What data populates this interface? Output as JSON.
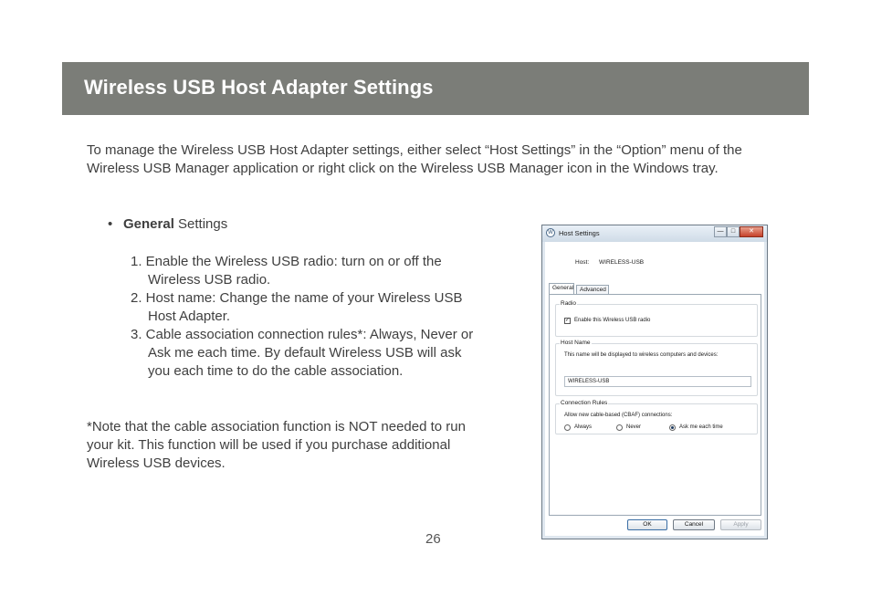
{
  "header": {
    "title": "Wireless USB Host Adapter Settings"
  },
  "intro": "To manage the Wireless USB Host Adapter settings, either select “Host Settings” in the “Option” menu of the Wireless USB Manager application or right click on the Wireless USB Manager icon in the Windows tray.",
  "bullet": {
    "marker": "•",
    "bold": "General",
    "rest": " Settings"
  },
  "steps": [
    "1. Enable the Wireless USB radio: turn on or off the Wireless USB radio.",
    "2. Host name: Change the name of your Wireless USB Host Adapter.",
    "3. Cable association connection rules*: Always, Never or Ask me each time.  By default Wireless USB will ask you each time to do the cable association."
  ],
  "note": "*Note that the cable association function is NOT needed to run your kit. This function will be used if you purchase additional Wireless USB devices.",
  "page_number": "26",
  "dialog": {
    "title": "Host Settings",
    "title_icon": "W",
    "window_buttons": {
      "minimize": "—",
      "maximize": "□",
      "close": "✕"
    },
    "host_label": "Host:",
    "host_value": "WIRELESS-USB",
    "tabs": [
      "General",
      "Advanced"
    ],
    "radio_group": {
      "title": "Radio",
      "checkbox_label": "Enable this Wireless USB radio",
      "checked": true,
      "check_mark": "✓"
    },
    "host_name_group": {
      "title": "Host Name",
      "description": "This name will be displayed to wireless computers and devices:",
      "value": "WIRELESS-USB"
    },
    "rules_group": {
      "title": "Connection Rules",
      "description": "Allow new cable-based (CBAF) connections:",
      "options": [
        "Always",
        "Never",
        "Ask me each time"
      ],
      "selected": "Ask me each time"
    },
    "buttons": {
      "ok": "OK",
      "cancel": "Cancel",
      "apply": "Apply"
    }
  }
}
